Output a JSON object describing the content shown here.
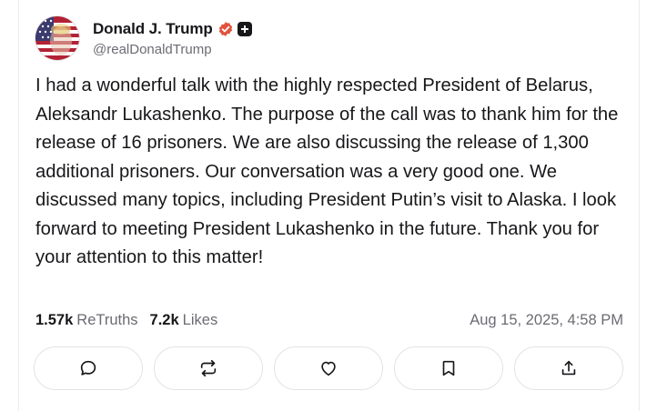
{
  "post": {
    "author": {
      "display_name": "Donald J. Trump",
      "handle": "@realDonaldTrump",
      "verified": true,
      "badge_icon": "plus-badge-icon",
      "avatar": "avatar-american-flag-face"
    },
    "text": "I had a wonderful talk with the highly respected President of Belarus, Aleksandr Lukashenko. The purpose of the call was to thank him for the release of 16 prisoners. We are also discussing the release of 1,300 additional prisoners. Our conversation was a very good one. We discussed many topics, including President Putin’s visit to Alaska. I look forward to meeting President Lukashenko in the future. Thank you for your attention to this matter!",
    "stats": {
      "retruths_count": "1.57k",
      "retruths_label": "ReTruths",
      "likes_count": "7.2k",
      "likes_label": "Likes"
    },
    "timestamp": "Aug 15, 2025, 4:58 PM"
  },
  "actions": [
    {
      "name": "reply",
      "icon": "comment-icon"
    },
    {
      "name": "retruth",
      "icon": "repost-icon"
    },
    {
      "name": "like",
      "icon": "heart-icon"
    },
    {
      "name": "bookmark",
      "icon": "bookmark-icon"
    },
    {
      "name": "share",
      "icon": "share-icon"
    }
  ],
  "colors": {
    "verified": "#e0533d",
    "text": "#17171a",
    "muted": "#6b6b73",
    "border": "#e3e3e8"
  }
}
